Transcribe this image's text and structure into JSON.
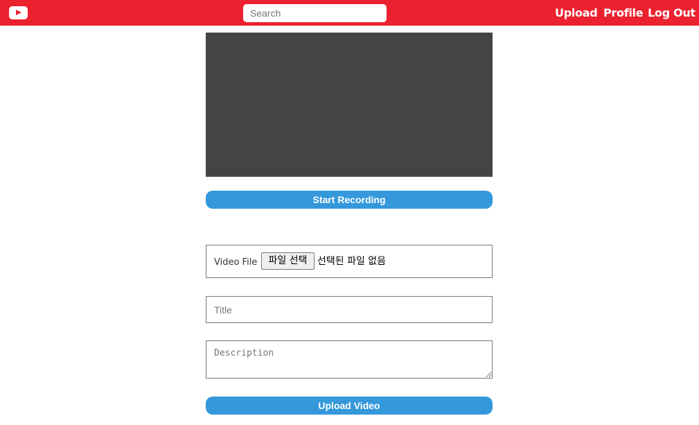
{
  "header": {
    "logo_icon": "youtube-play-icon",
    "search_placeholder": "Search",
    "nav": {
      "upload": "Upload",
      "profile": "Profile",
      "logout": "Log Out"
    }
  },
  "recorder": {
    "start_button": "Start Recording"
  },
  "form": {
    "video_file_label": "Video File",
    "file_button": "파일 선택",
    "file_status": "선택된 파일 없음",
    "title_placeholder": "Title",
    "description_placeholder": "Description",
    "submit_button": "Upload Video"
  },
  "colors": {
    "header_bg": "#ec212f",
    "button_bg": "#3498db",
    "preview_bg": "#444444"
  }
}
